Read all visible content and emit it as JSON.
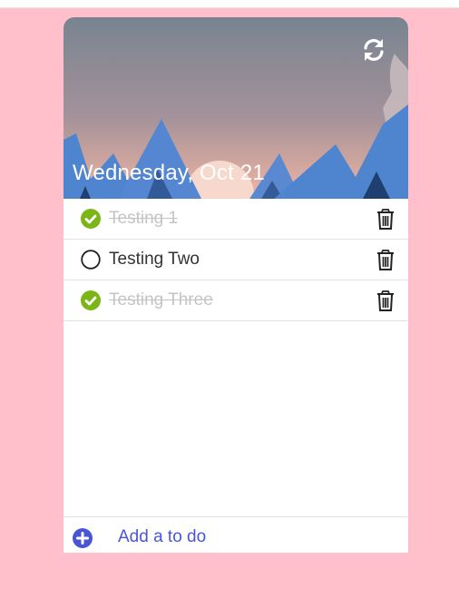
{
  "header": {
    "date": "Wednesday, Oct 21",
    "refresh_icon": "refresh-icon"
  },
  "todos": [
    {
      "label": "Testing 1",
      "done": true
    },
    {
      "label": "Testing Two",
      "done": false
    },
    {
      "label": "Testing Three",
      "done": true
    }
  ],
  "footer": {
    "add_label": "Add a to do",
    "add_icon": "plus-circle-icon"
  },
  "colors": {
    "page_bg": "#ffc0cb",
    "check_done": "#7cb518",
    "accent": "#4a55d6"
  }
}
